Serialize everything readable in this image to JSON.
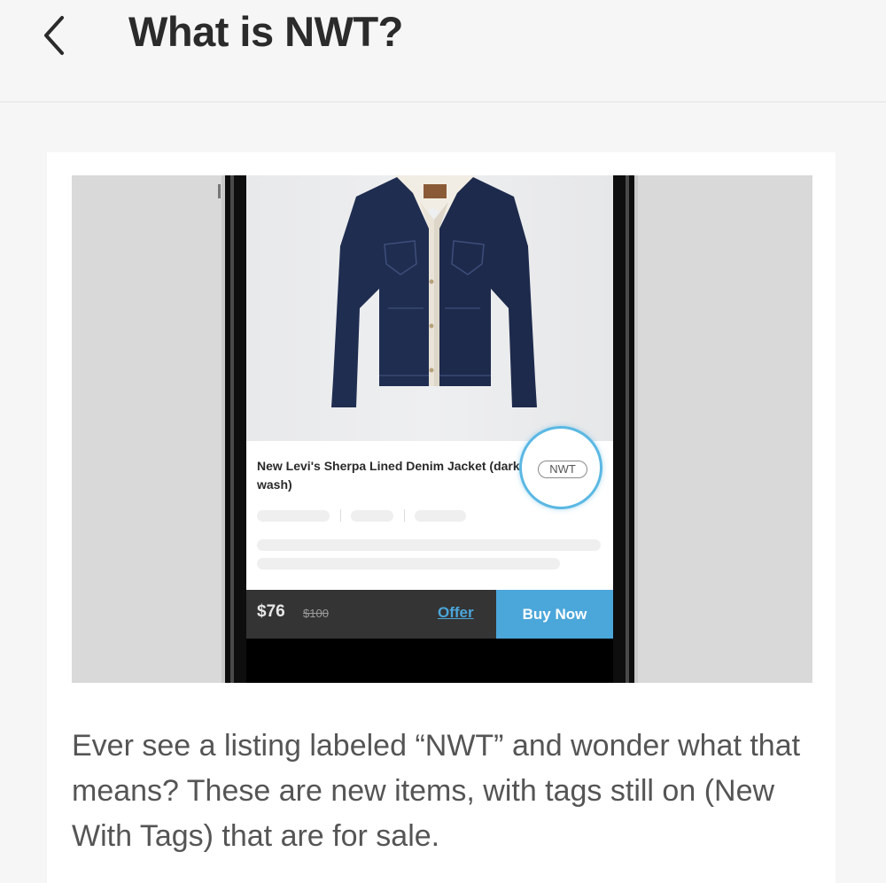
{
  "header": {
    "title": "What is NWT?",
    "back_icon": "chevron-left-icon"
  },
  "hero": {
    "listing": {
      "title": "New Levi's Sherpa Lined Denim Jacket (dark wash)",
      "badge": "NWT",
      "price": "$76",
      "original_price": "$100",
      "offer_label": "Offer",
      "buy_label": "Buy Now"
    },
    "colors": {
      "accent": "#4ba6da",
      "denim": "#1d2b4e",
      "bar": "#343434"
    }
  },
  "body": {
    "description": "Ever see a listing labeled “NWT” and wonder what that means? These are new items, with tags still on (New With Tags) that are for sale."
  }
}
